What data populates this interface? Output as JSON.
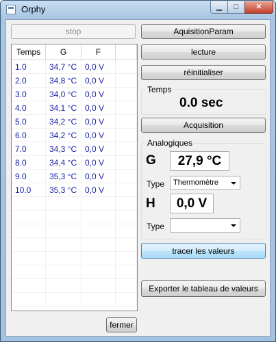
{
  "window": {
    "title": "Orphy"
  },
  "buttons": {
    "stop": "stop",
    "aquisition_param": "AquisitionParam",
    "lecture": "lecture",
    "reinitialiser": "réinitialiser",
    "acquisition": "Acquisition",
    "tracer": "tracer les valeurs",
    "exporter": "Exporter le tableau de valeurs",
    "fermer": "fermer"
  },
  "table": {
    "columns": [
      "Temps",
      "G",
      "F",
      ""
    ],
    "rows": [
      [
        "1.0",
        "34,7 °C",
        "0,0 V"
      ],
      [
        "2.0",
        "34,8 °C",
        "0,0 V"
      ],
      [
        "3.0",
        "34,0 °C",
        "0,0 V"
      ],
      [
        "4.0",
        "34,1 °C",
        "0,0 V"
      ],
      [
        "5.0",
        "34,2 °C",
        "0,0 V"
      ],
      [
        "6.0",
        "34,2 °C",
        "0,0 V"
      ],
      [
        "7.0",
        "34,3 °C",
        "0,0 V"
      ],
      [
        "8.0",
        "34,4 °C",
        "0,0 V"
      ],
      [
        "9.0",
        "35,3 °C",
        "0,0 V"
      ],
      [
        "10.0",
        "35,3 °C",
        "0,0 V"
      ]
    ]
  },
  "temps_group": {
    "label": "Temps",
    "value": "0.0 sec"
  },
  "analog_group": {
    "label": "Analogiques",
    "g": {
      "name": "G",
      "value": "27,9 °C",
      "type_label": "Type",
      "type_value": "Thermomètre"
    },
    "h": {
      "name": "H",
      "value": "0,0 V",
      "type_label": "Type",
      "type_value": ""
    }
  }
}
